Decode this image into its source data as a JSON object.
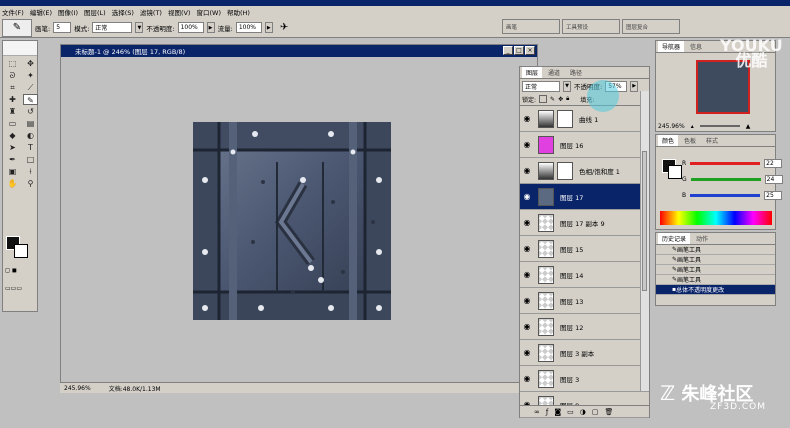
{
  "app": {
    "title": "Adobe Photoshop"
  },
  "menu": [
    "文件(F)",
    "编辑(E)",
    "图像(I)",
    "图层(L)",
    "选择(S)",
    "滤镜(T)",
    "视图(V)",
    "窗口(W)",
    "帮助(H)"
  ],
  "options": {
    "brush_label": "画笔:",
    "brush_size": "5",
    "mode_label": "模式:",
    "mode_value": "正常",
    "opacity_label": "不透明度:",
    "opacity_value": "100%",
    "flow_label": "流量:",
    "flow_value": "100%"
  },
  "palette_well": [
    "画笔",
    "工具预设",
    "图层复合"
  ],
  "document": {
    "title": "未标题-1 @ 246% (图层 17, RGB/8)",
    "zoom": "245.96%",
    "doc_size": "文档:48.0K/1.13M"
  },
  "layers_panel": {
    "tabs": [
      "图层",
      "通道",
      "路径"
    ],
    "blend_mode": "正常",
    "opacity_label": "不透明度:",
    "opacity_value": "57%",
    "lock_label": "锁定:",
    "fill_label": "填充:",
    "layers": [
      {
        "name": "曲线 1",
        "thumb": "adj",
        "mask": true,
        "selected": false
      },
      {
        "name": "图层 16",
        "thumb": "mag",
        "mask": false,
        "selected": false
      },
      {
        "name": "色相/饱和度 1",
        "thumb": "adj",
        "mask": true,
        "selected": false
      },
      {
        "name": "图层 17",
        "thumb": "met",
        "mask": false,
        "selected": true
      },
      {
        "name": "图层 17 副本 9",
        "thumb": "chk",
        "mask": false,
        "selected": false
      },
      {
        "name": "图层 15",
        "thumb": "chk",
        "mask": false,
        "selected": false
      },
      {
        "name": "图层 14",
        "thumb": "chk",
        "mask": false,
        "selected": false
      },
      {
        "name": "图层 13",
        "thumb": "chk",
        "mask": false,
        "selected": false
      },
      {
        "name": "图层 12",
        "thumb": "chk",
        "mask": false,
        "selected": false
      },
      {
        "name": "图层 3 副本",
        "thumb": "chk",
        "mask": false,
        "selected": false
      },
      {
        "name": "图层 3",
        "thumb": "chk",
        "mask": false,
        "selected": false
      },
      {
        "name": "图层 9",
        "thumb": "chk",
        "mask": false,
        "selected": false
      }
    ]
  },
  "navigator": {
    "tabs": [
      "导航器",
      "信息"
    ],
    "zoom": "245.96%"
  },
  "color_panel": {
    "tabs": [
      "颜色",
      "色板",
      "样式"
    ],
    "r": {
      "label": "R",
      "value": "22",
      "color": "#e02020"
    },
    "g": {
      "label": "G",
      "value": "24",
      "color": "#20a020"
    },
    "b": {
      "label": "B",
      "value": "25",
      "color": "#2040d0"
    }
  },
  "history_panel": {
    "tabs": [
      "历史记录",
      "动作"
    ],
    "items": [
      {
        "name": "画笔工具",
        "selected": false
      },
      {
        "name": "画笔工具",
        "selected": false
      },
      {
        "name": "画笔工具",
        "selected": false
      },
      {
        "name": "画笔工具",
        "selected": false
      },
      {
        "name": "总体不透明度更改",
        "selected": true
      }
    ]
  },
  "watermarks": {
    "youku_top": "YOUKU",
    "youku_bottom": "优酷",
    "site_cn": "朱峰社区",
    "site_url": "ZF3D.COM"
  }
}
